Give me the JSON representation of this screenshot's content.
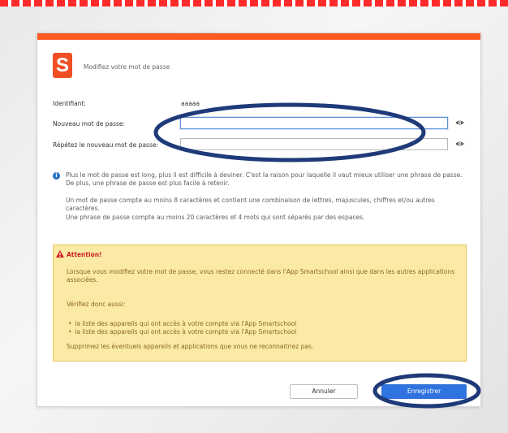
{
  "dialog": {
    "title": "Modifiez votre mot de passe",
    "logo_letter": "S",
    "accent_color": "#ff5a1f"
  },
  "form": {
    "identifier_label": "Identifiant:",
    "identifier_value": "aaaaa",
    "new_password_label": "Nouveau mot de passe:",
    "repeat_password_label": "Répétez le nouveau mot de passe:",
    "new_password_value": "",
    "repeat_password_value": ""
  },
  "info": {
    "p1": "Plus le mot de passe est long, plus il est difficile à deviner. C'est la raison pour laquelle il vaut mieux utiliser une phrase de passe. De plus, une phrase de passe est plus facile à retenir.",
    "p2": "Un mot de passe compte au moins 8 caractères et contient une combinaison de lettres, majuscules, chiffres et/ou autres caractères.",
    "p3": "Une phrase de passe compte au moins 20 caractères et 4 mots qui sont séparés par des espaces."
  },
  "warning": {
    "title": "Attention!",
    "p1": "Lorsque vous modifiez votre mot de passe, vous restez connecté dans l'App Smartschool ainsi que dans les autres applications associées.",
    "p2": "Vérifiez donc aussi:",
    "items": [
      "la liste des appareils qui ont accès à votre compte via l'App Smartschool",
      "la liste des appareils qui ont accès à votre compte via l'App Smartschool"
    ],
    "p3": "Supprimez les éventuels appareils et applications que vous ne reconnaitriez pas."
  },
  "buttons": {
    "cancel": "Annuler",
    "save": "Enregistrer"
  }
}
